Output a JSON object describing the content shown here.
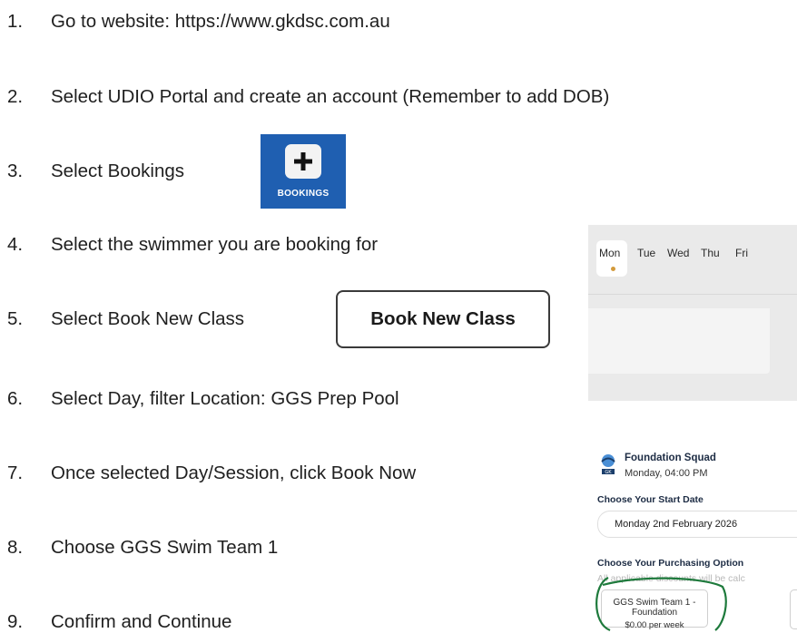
{
  "steps": [
    {
      "num": "1.",
      "text": "Go to website: https://www.gkdsc.com.au"
    },
    {
      "num": "2.",
      "text": "Select UDIO Portal and create an account (Remember to add DOB)"
    },
    {
      "num": "3.",
      "text": "Select Bookings"
    },
    {
      "num": "4.",
      "text": "Select the swimmer you are booking for"
    },
    {
      "num": "5.",
      "text": "Select Book New Class"
    },
    {
      "num": "6.",
      "text": "Select Day, filter Location: GGS Prep Pool"
    },
    {
      "num": "7.",
      "text": "Once selected Day/Session, click Book Now"
    },
    {
      "num": "8.",
      "text": "Choose GGS Swim Team 1"
    },
    {
      "num": "9.",
      "text": "Confirm and Continue"
    }
  ],
  "bookings_icon": {
    "caption": "BOOKINGS",
    "icon": "plus-icon",
    "color": "#1f5fb1"
  },
  "book_new_class": {
    "label": "Book New Class"
  },
  "day_strip": {
    "days": [
      "Mon",
      "Tue",
      "Wed",
      "Thu",
      "Fri"
    ],
    "selected": "Mon",
    "dot_color": "#d39a3c"
  },
  "squad": {
    "name": "Foundation Squad",
    "time": "Monday, 04:00 PM",
    "start_label": "Choose Your Start Date",
    "start_value": "Monday 2nd February 2026",
    "purchase_label": "Choose Your Purchasing Option",
    "discount_note": "All applicable discounts will be calc",
    "option_title": "GGS Swim Team 1 - Foundation",
    "option_price": "$0.00 per week",
    "highlight_color": "#1e7a3c"
  }
}
